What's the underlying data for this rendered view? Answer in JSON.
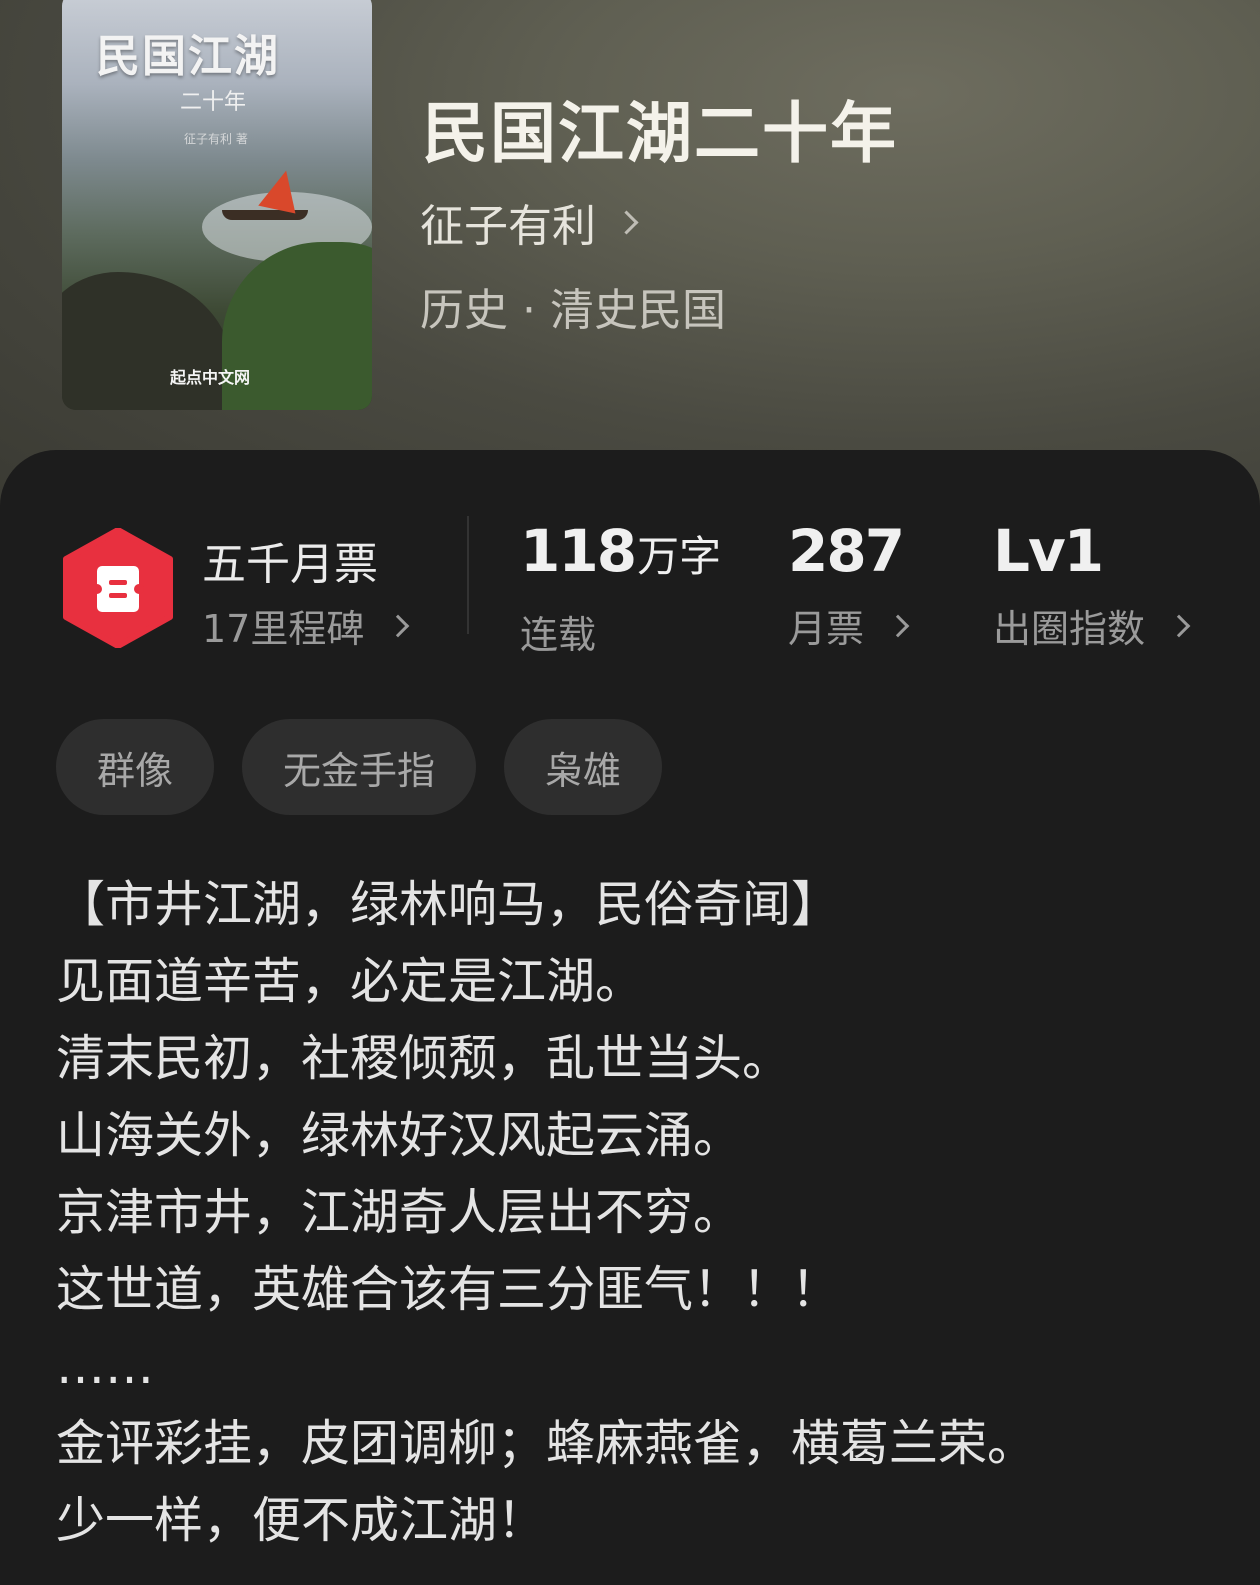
{
  "cover": {
    "title_art": "民国江湖",
    "subtitle_art": "二十年",
    "author_art": "征子有利 著",
    "publisher_art": "起点中文网"
  },
  "book": {
    "title": "民国江湖二十年",
    "author": "征子有利",
    "genre": "历史 · 清史民国"
  },
  "ticket": {
    "title": "五千月票",
    "milestone": "17里程碑",
    "badge_color": "#e8303f"
  },
  "stats": [
    {
      "value": "118",
      "unit": "万字",
      "label": "连载"
    },
    {
      "value": "287",
      "unit": "",
      "label": "月票"
    },
    {
      "value": "Lv1",
      "unit": "",
      "label": "出圈指数"
    }
  ],
  "tags": [
    "群像",
    "无金手指",
    "枭雄"
  ],
  "synopsis": [
    "【市井江湖，绿林响马，民俗奇闻】",
    "见面道辛苦，必定是江湖。",
    "清末民初，社稷倾颓，乱世当头。",
    "山海关外，绿林好汉风起云涌。",
    "京津市井，江湖奇人层出不穷。",
    "这世道，英雄合该有三分匪气！！！",
    "……",
    "金评彩挂，皮团调柳；蜂麻燕雀，横葛兰荣。",
    "少一样，便不成江湖！"
  ],
  "colors": {
    "accent": "#e8303f",
    "panel": "#1c1c1c",
    "tag_bg": "#2e2e2e"
  }
}
